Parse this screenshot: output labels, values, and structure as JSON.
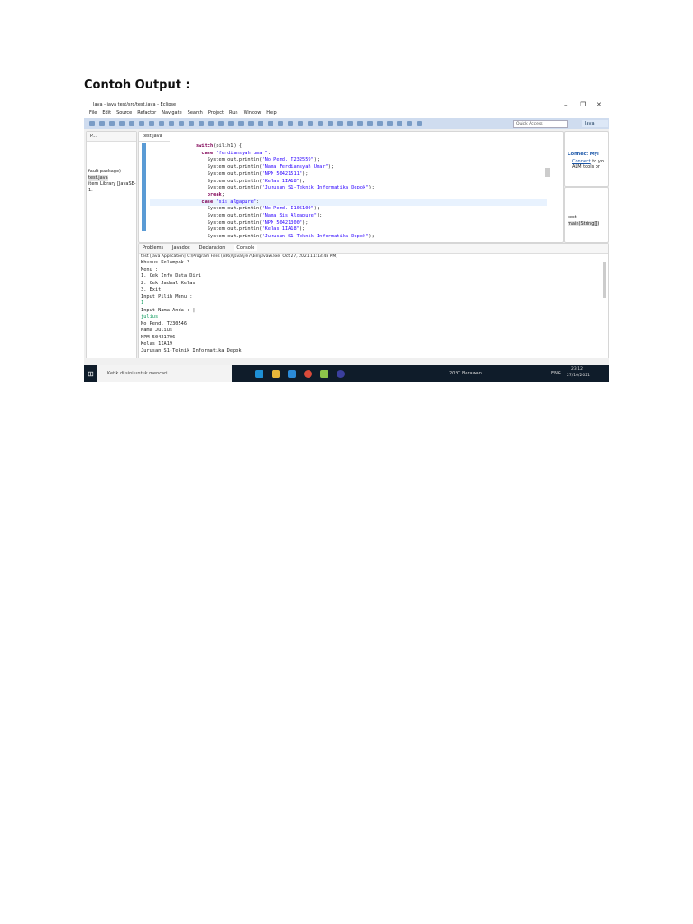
{
  "heading": "Contoh Output :",
  "window": {
    "title": "Java - java test/src/test.java - Eclipse",
    "min": "–",
    "max": "❐",
    "close": "✕"
  },
  "menu": [
    "File",
    "Edit",
    "Source",
    "Refactor",
    "Navigate",
    "Search",
    "Project",
    "Run",
    "Window",
    "Help"
  ],
  "quick_access": "Quick Access",
  "perspective": "Java",
  "left_panel": {
    "tab": "P...",
    "items": [
      "fault package)",
      "test.java",
      "item Library [JavaSE-1."
    ]
  },
  "editor": {
    "tab": "test.java",
    "lines": [
      {
        "indent": "          ",
        "kw": "switch",
        "rest": "(pilih1) {"
      },
      {
        "indent": "            ",
        "kw": "case ",
        "str": "\"ferdiansyah umar\"",
        "rest": ":"
      },
      {
        "indent": "              ",
        "pre": "System.out.println(",
        "str": "\"No Pend. T232559\"",
        "rest": ");"
      },
      {
        "indent": "              ",
        "pre": "System.out.println(",
        "str": "\"Nama Ferdiansyah Umar\"",
        "rest": ");"
      },
      {
        "indent": "              ",
        "pre": "System.out.println(",
        "str": "\"NPM 50421511\"",
        "rest": ");"
      },
      {
        "indent": "              ",
        "pre": "System.out.println(",
        "str": "\"Kelas 1IA18\"",
        "rest": ");"
      },
      {
        "indent": "              ",
        "pre": "System.out.println(",
        "str": "\"Jurusan S1-Teknik Informatika Depok\"",
        "rest": ");"
      },
      {
        "indent": "              ",
        "kw": "break",
        "rest": ";"
      },
      {
        "indent": "            ",
        "kw": "case ",
        "str": "\"sis algapure\"",
        "rest": ":"
      },
      {
        "indent": "              ",
        "pre": "System.out.println(",
        "str": "\"No Pend. I105100\"",
        "rest": ");"
      },
      {
        "indent": "              ",
        "pre": "System.out.println(",
        "str": "\"Nama Sis Algapure\"",
        "rest": ");"
      },
      {
        "indent": "              ",
        "pre": "System.out.println(",
        "str": "\"NPM 50421300\"",
        "rest": ");"
      },
      {
        "indent": "              ",
        "pre": "System.out.println(",
        "str": "\"Kelas 1IA18\"",
        "rest": ");"
      },
      {
        "indent": "              ",
        "pre": "System.out.println(",
        "str": "\"Jurusan S1-Teknik Informatika Depok\"",
        "rest": ");"
      }
    ]
  },
  "right_panel": {
    "connect_title": "Connect Myl",
    "connect_link": "Connect",
    "connect_text": "to yo",
    "connect_text2": "ALM tools or",
    "outline_item1": "test",
    "outline_item2": "main(String[])"
  },
  "console": {
    "tabs": [
      "Problems",
      "Javadoc",
      "Declaration",
      "Console"
    ],
    "header": "test [Java Application] C:\\Program Files (x86)\\Java\\jre7\\bin\\javaw.exe (Oct 27, 2021 11:13:48 PM)",
    "lines": [
      {
        "t": "Khusus Kelompok 3"
      },
      {
        "t": "Menu :"
      },
      {
        "t": "1. Cek Info Data Diri"
      },
      {
        "t": "2. Cek Jadwal Kelas"
      },
      {
        "t": "3. Exit"
      },
      {
        "t": "Input Pilih Menu :"
      },
      {
        "t": "1",
        "input": true
      },
      {
        "t": "Input Nama Anda : |"
      },
      {
        "t": "julius",
        "input": true
      },
      {
        "t": "No Pend. T230546"
      },
      {
        "t": "Nama Julius"
      },
      {
        "t": "NPM 50421706"
      },
      {
        "t": "Kelas 1IA19"
      },
      {
        "t": "Jurusan S1-Teknik Informatika Depok"
      }
    ]
  },
  "taskbar": {
    "search": "Ketik di sini untuk mencari",
    "weather": "20°C Berawan",
    "lang": "ENG",
    "time": "23:12",
    "date": "27/10/2021"
  }
}
